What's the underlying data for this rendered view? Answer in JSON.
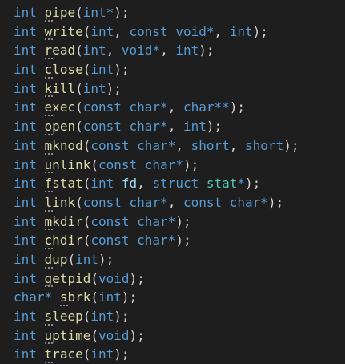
{
  "editor": {
    "colors": {
      "background": "#1e1e1e",
      "keyword": "#569cd6",
      "function": "#dcdcaa",
      "punctuation": "#d4d4d4",
      "parameter": "#9cdcfe",
      "struct_type": "#4ec9b0"
    },
    "lines": [
      {
        "ret": "int",
        "sp": " ",
        "name": "pipe",
        "params": [
          {
            "kind": "ty",
            "t": "int*"
          }
        ],
        "end": ");"
      },
      {
        "ret": "int",
        "sp": " ",
        "name": "write",
        "params": [
          {
            "kind": "ty",
            "t": "int"
          },
          {
            "kind": "pn",
            "t": ", "
          },
          {
            "kind": "ty",
            "t": "const void*"
          },
          {
            "kind": "pn",
            "t": ", "
          },
          {
            "kind": "ty",
            "t": "int"
          }
        ],
        "end": ");"
      },
      {
        "ret": "int",
        "sp": " ",
        "name": "read",
        "params": [
          {
            "kind": "ty",
            "t": "int"
          },
          {
            "kind": "pn",
            "t": ", "
          },
          {
            "kind": "ty",
            "t": "void*"
          },
          {
            "kind": "pn",
            "t": ", "
          },
          {
            "kind": "ty",
            "t": "int"
          }
        ],
        "end": ");"
      },
      {
        "ret": "int",
        "sp": " ",
        "name": "close",
        "params": [
          {
            "kind": "ty",
            "t": "int"
          }
        ],
        "end": ");"
      },
      {
        "ret": "int",
        "sp": " ",
        "name": "kill",
        "params": [
          {
            "kind": "ty",
            "t": "int"
          }
        ],
        "end": ");"
      },
      {
        "ret": "int",
        "sp": " ",
        "name": "exec",
        "params": [
          {
            "kind": "ty",
            "t": "const char*"
          },
          {
            "kind": "pn",
            "t": ", "
          },
          {
            "kind": "ty",
            "t": "char**"
          }
        ],
        "end": ");"
      },
      {
        "ret": "int",
        "sp": " ",
        "name": "open",
        "params": [
          {
            "kind": "ty",
            "t": "const char*"
          },
          {
            "kind": "pn",
            "t": ", "
          },
          {
            "kind": "ty",
            "t": "int"
          }
        ],
        "end": ");"
      },
      {
        "ret": "int",
        "sp": " ",
        "name": "mknod",
        "params": [
          {
            "kind": "ty",
            "t": "const char*"
          },
          {
            "kind": "pn",
            "t": ", "
          },
          {
            "kind": "ty",
            "t": "short"
          },
          {
            "kind": "pn",
            "t": ", "
          },
          {
            "kind": "ty",
            "t": "short"
          }
        ],
        "end": ");"
      },
      {
        "ret": "int",
        "sp": " ",
        "name": "unlink",
        "params": [
          {
            "kind": "ty",
            "t": "const char*"
          }
        ],
        "end": ");"
      },
      {
        "ret": "int",
        "sp": " ",
        "name": "fstat",
        "params": [
          {
            "kind": "ty",
            "t": "int"
          },
          {
            "kind": "pn",
            "t": " "
          },
          {
            "kind": "pr",
            "t": "fd"
          },
          {
            "kind": "pn",
            "t": ", "
          },
          {
            "kind": "ty",
            "t": "struct"
          },
          {
            "kind": "pn",
            "t": " "
          },
          {
            "kind": "st",
            "t": "stat"
          },
          {
            "kind": "ty",
            "t": "*"
          }
        ],
        "end": ");"
      },
      {
        "ret": "int",
        "sp": " ",
        "name": "link",
        "params": [
          {
            "kind": "ty",
            "t": "const char*"
          },
          {
            "kind": "pn",
            "t": ", "
          },
          {
            "kind": "ty",
            "t": "const char*"
          }
        ],
        "end": ");"
      },
      {
        "ret": "int",
        "sp": " ",
        "name": "mkdir",
        "params": [
          {
            "kind": "ty",
            "t": "const char*"
          }
        ],
        "end": ");"
      },
      {
        "ret": "int",
        "sp": " ",
        "name": "chdir",
        "params": [
          {
            "kind": "ty",
            "t": "const char*"
          }
        ],
        "end": ");"
      },
      {
        "ret": "int",
        "sp": " ",
        "name": "dup",
        "params": [
          {
            "kind": "ty",
            "t": "int"
          }
        ],
        "end": ");"
      },
      {
        "ret": "int",
        "sp": " ",
        "name": "getpid",
        "params": [
          {
            "kind": "ty",
            "t": "void"
          }
        ],
        "end": ");"
      },
      {
        "ret": "char*",
        "sp": " ",
        "name": "sbrk",
        "params": [
          {
            "kind": "ty",
            "t": "int"
          }
        ],
        "end": ");"
      },
      {
        "ret": "int",
        "sp": " ",
        "name": "sleep",
        "params": [
          {
            "kind": "ty",
            "t": "int"
          }
        ],
        "end": ");"
      },
      {
        "ret": "int",
        "sp": " ",
        "name": "uptime",
        "params": [
          {
            "kind": "ty",
            "t": "void"
          }
        ],
        "end": ");"
      },
      {
        "ret": "int",
        "sp": " ",
        "name": "trace",
        "params": [
          {
            "kind": "ty",
            "t": "int"
          }
        ],
        "end": ");"
      }
    ]
  }
}
